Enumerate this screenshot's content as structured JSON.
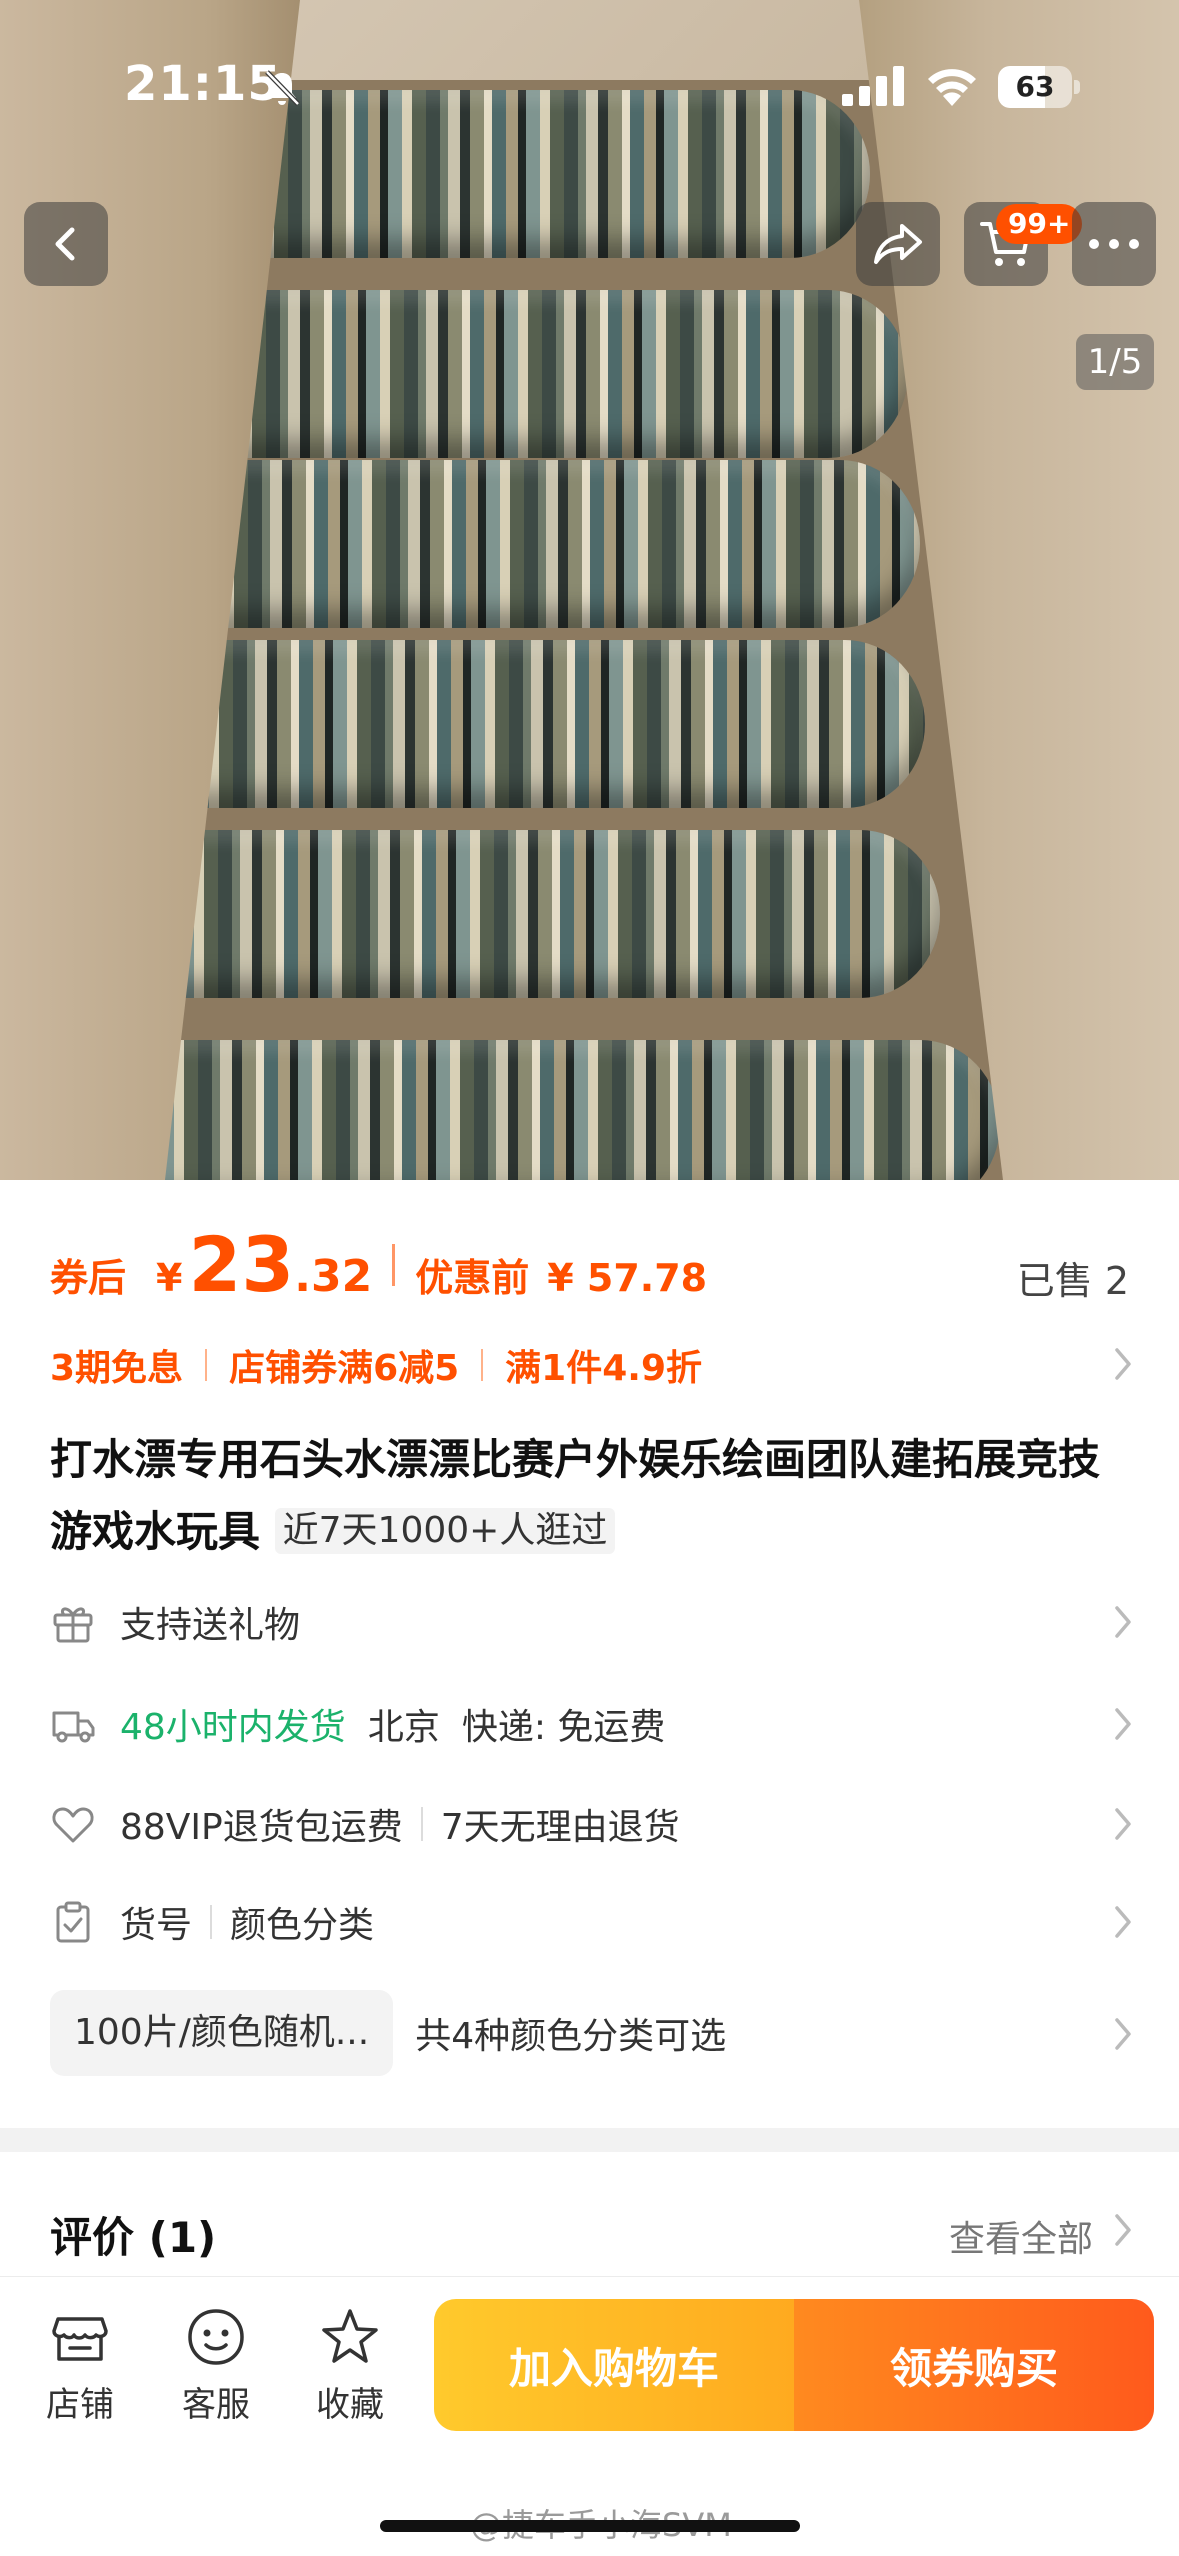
{
  "status_bar": {
    "time": "21:15",
    "battery": "63",
    "battery_level": 0.63
  },
  "gallery": {
    "page_indicator": "1/5",
    "cart_badge": "99+"
  },
  "price": {
    "prefix": "券后",
    "currency": "¥",
    "integer": "23",
    "decimal": ".32",
    "original_label": "优惠前",
    "original_value": "¥ 57.78",
    "sold": "已售 2"
  },
  "promos": [
    "3期免息",
    "店铺券满6减5",
    "满1件4.9折"
  ],
  "title": {
    "text": "打水漂专用石头水漂漂比赛户外娱乐绘画团队建拓展竞技游戏水玩具",
    "tag": "近7天1000+人逛过"
  },
  "features": {
    "gift": "支持送礼物",
    "shipping_time": "48小时内发货",
    "shipping_from": "北京",
    "shipping_fee": "快递: 免运费",
    "return_vip": "88VIP退货包运费",
    "return_policy": "7天无理由退货",
    "sku_label": "货号",
    "sku_category": "颜色分类"
  },
  "sku": {
    "selected": "100片/颜色随机...",
    "summary": "共4种颜色分类可选"
  },
  "reviews": {
    "title": "评价 (1)",
    "view_all": "查看全部"
  },
  "bottom_bar": {
    "shop": "店铺",
    "service": "客服",
    "favorite": "收藏",
    "add_to_cart": "加入购物车",
    "buy": "领券购买"
  },
  "watermark": "@捷车手小海SVM",
  "colors": {
    "accent": "#ff5000",
    "green": "#1bb26b",
    "cta_yellow": "#ffb824",
    "cta_orange": "#ff6a1c"
  }
}
